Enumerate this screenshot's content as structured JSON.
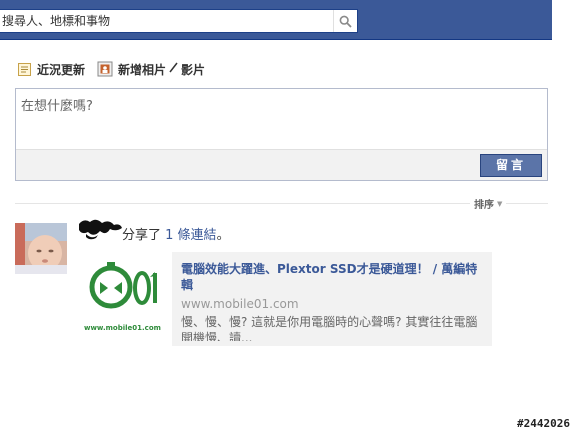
{
  "search": {
    "placeholder": "搜尋人、地標和事物"
  },
  "composer": {
    "tabs": [
      {
        "label": "近況更新",
        "icon": "status-note-icon"
      },
      {
        "label": "新增相片",
        "icon": "photo-icon"
      },
      {
        "label": "影片",
        "icon": "video-icon"
      }
    ],
    "photo_video_separator": "⁄",
    "prompt": "在想什麼嗎?",
    "post_button": "留言"
  },
  "feed": {
    "sort_label": "排序",
    "story": {
      "action_prefix": "分享了",
      "link_text": "1 條連結",
      "action_suffix": "。",
      "attachment": {
        "title": "電腦效能大躍進、Plextor SSD才是硬道理！ / 萬編特輯",
        "domain": "www.mobile01.com",
        "description": "慢、慢、慢? 這就是你用電腦時的心聲嗎? 其實往往電腦開機慢、讀...",
        "thumb_caption": "www.mobile01.com"
      }
    }
  },
  "watermark": "#2442026",
  "colors": {
    "brand_blue": "#3b5998",
    "button_blue": "#5b74a8",
    "mobile01_green": "#2e8b3a"
  }
}
